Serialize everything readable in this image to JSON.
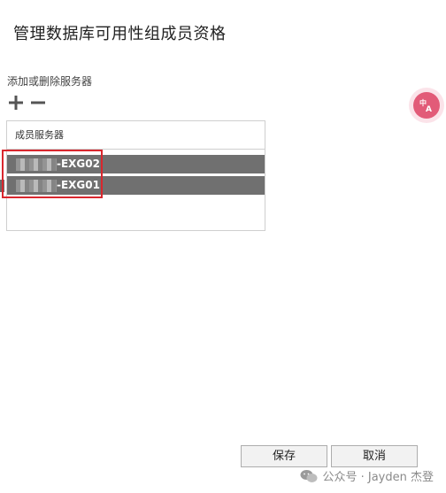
{
  "dialog": {
    "title": "管理数据库可用性组成员资格",
    "section_label": "添加或删除服务器",
    "list_header": "成员服务器",
    "servers": [
      {
        "suffix": "-EXG02"
      },
      {
        "suffix": "-EXG01"
      }
    ],
    "save_label": "保存",
    "cancel_label": "取消"
  },
  "watermark": {
    "text": "公众号 · Jayden 杰登"
  },
  "colors": {
    "selected_row": "#707070",
    "highlight_border": "#d9272e",
    "translate_badge": "#e25b78"
  },
  "icons": {
    "add": "plus-icon",
    "remove": "minus-icon",
    "translate": "translate-icon",
    "watermark": "wechat-icon"
  }
}
